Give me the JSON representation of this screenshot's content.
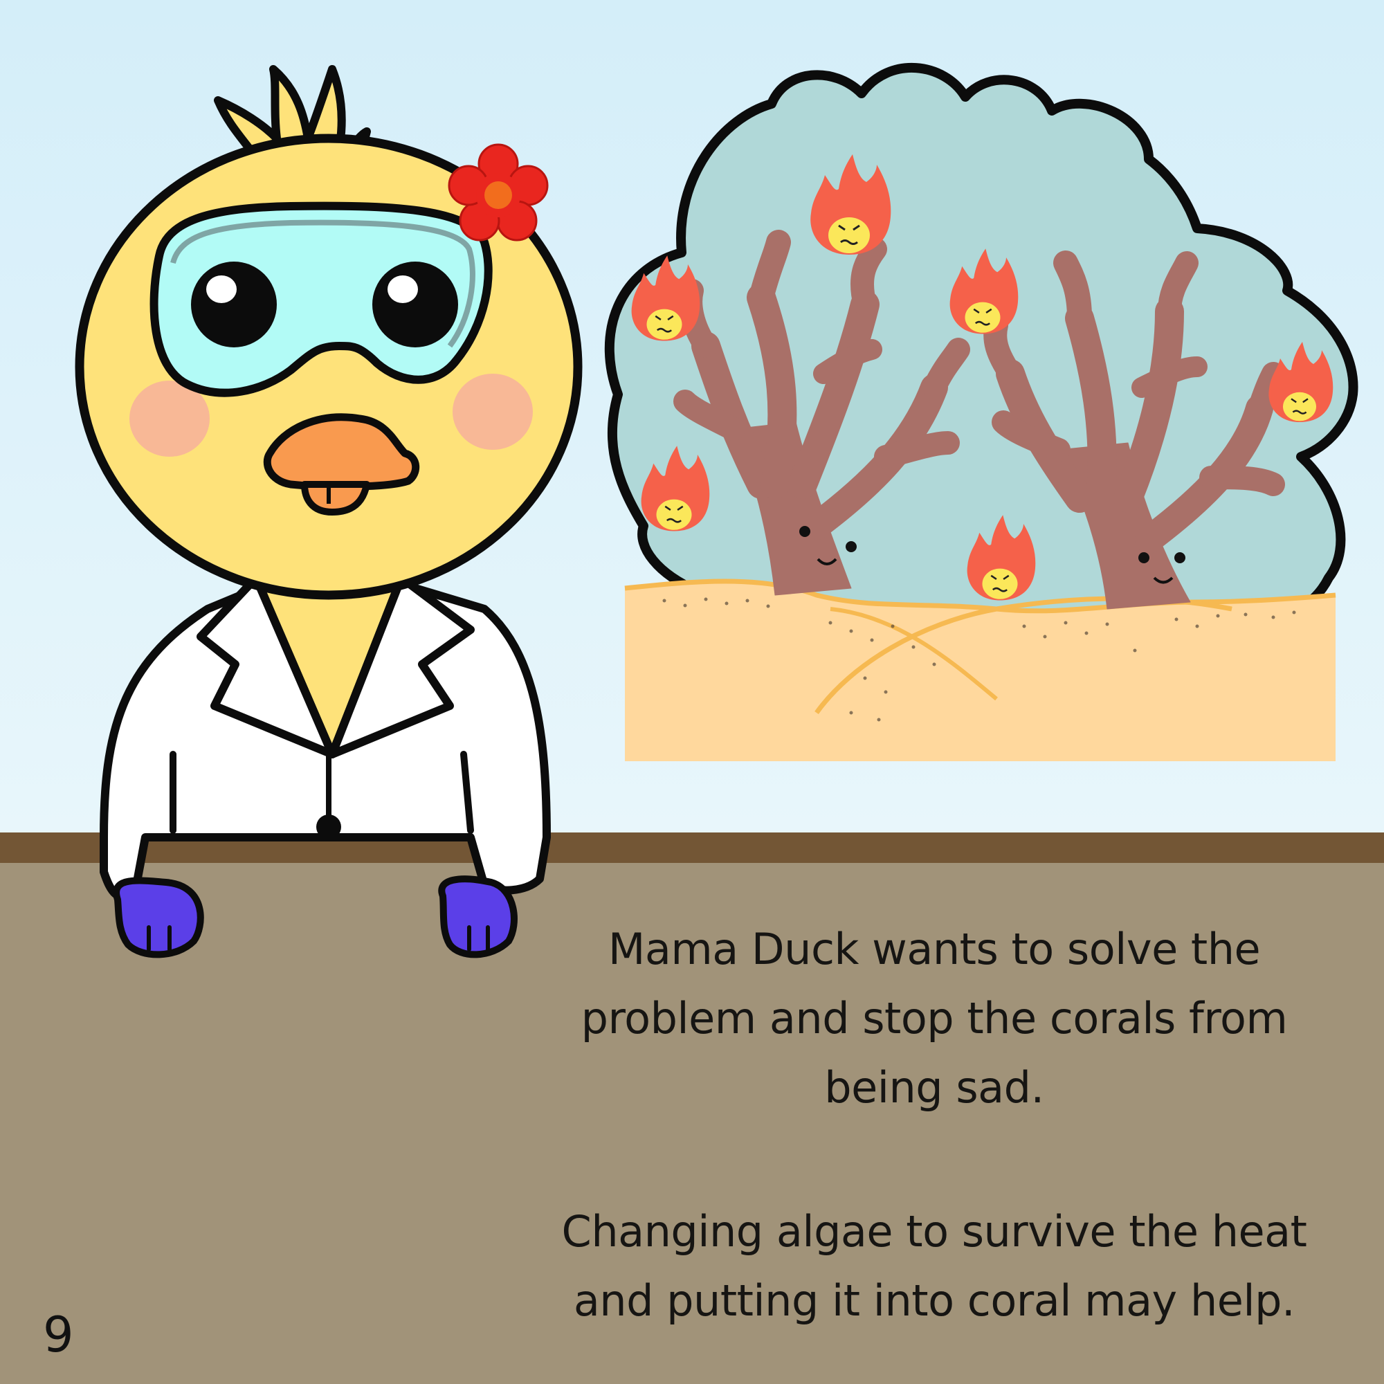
{
  "story": {
    "paragraph_1": "Mama Duck wants to solve the problem and stop the corals from being sad.",
    "paragraph_2": "Changing algae to survive the heat and putting it into coral may help."
  },
  "page_number": "9",
  "colors": {
    "sky_top": "#d4eef9",
    "sky_bottom": "#e7f5fb",
    "table_top": "#735635",
    "table": "#a19379",
    "duck_yellow": "#fee27a",
    "goggle_lens": "#b2fbf6",
    "beak": "#f99a4f",
    "cheek": "#f8b896",
    "flower": "#e9261f",
    "flower_center": "#f26d1d",
    "glove": "#5b3fe8",
    "thought_water": "#b0d8d8",
    "coral": "#a97068",
    "sand": "#ffd89d",
    "flame": "#f5614a",
    "flame_face": "#fbe75a"
  },
  "icons": [
    "duck-scientist",
    "flower-icon",
    "thought-bubble",
    "coral-icon",
    "angry-flame-icon"
  ]
}
